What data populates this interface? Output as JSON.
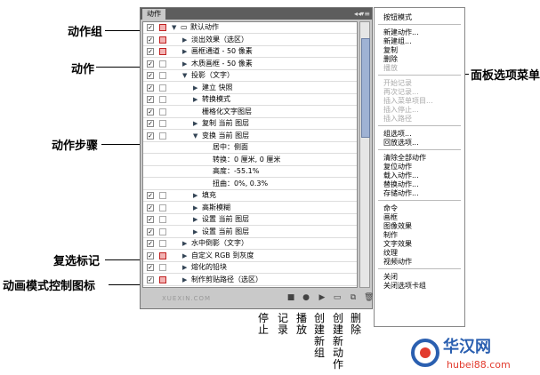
{
  "callouts": {
    "action_set": "动作组",
    "action": "动作",
    "action_step": "动作步骤",
    "toggle_check": "复选标记",
    "dialog_toggle": "动画模式控制图标",
    "panel_menu": "面板选项菜单"
  },
  "panel": {
    "tab": "动作",
    "collapse": "◂◂",
    "menu_icon": "▾≡",
    "watermark": "XUEXIN.COM",
    "rows": [
      {
        "label": "默认动作",
        "check": "✓",
        "dialog": "red",
        "tri": "▼",
        "indent": 0,
        "folder": true
      },
      {
        "label": "淡出效果（选区）",
        "check": "✓",
        "dialog": "red",
        "tri": "▶",
        "indent": 1
      },
      {
        "label": "画框通道 - 50 像素",
        "check": "✓",
        "dialog": "red",
        "tri": "▶",
        "indent": 1
      },
      {
        "label": "木质画框 - 50 像素",
        "check": "✓",
        "dialog": "",
        "tri": "▶",
        "indent": 1
      },
      {
        "label": "投影（文字）",
        "check": "✓",
        "dialog": "",
        "tri": "▼",
        "indent": 1
      },
      {
        "label": "建立 快照",
        "check": "✓",
        "dialog": "",
        "tri": "▶",
        "indent": 2
      },
      {
        "label": "转换模式",
        "check": "✓",
        "dialog": "",
        "tri": "▶",
        "indent": 2
      },
      {
        "label": "栅格化文字图层",
        "check": "✓",
        "dialog": "",
        "tri": "",
        "indent": 2
      },
      {
        "label": "复制 当前 图层",
        "check": "✓",
        "dialog": "",
        "tri": "▶",
        "indent": 2
      },
      {
        "label": "变换 当前 图层",
        "check": "✓",
        "dialog": "",
        "tri": "▼",
        "indent": 2
      },
      {
        "label": "居中：侧面",
        "check": "",
        "dialog": "none",
        "tri": "",
        "indent": 3
      },
      {
        "label": "转换：0 厘米, 0 厘米",
        "check": "",
        "dialog": "none",
        "tri": "",
        "indent": 3
      },
      {
        "label": "高度：-55.1%",
        "check": "",
        "dialog": "none",
        "tri": "",
        "indent": 3
      },
      {
        "label": "扭曲：0%, 0.3%",
        "check": "",
        "dialog": "none",
        "tri": "",
        "indent": 3
      },
      {
        "label": "填充",
        "check": "✓",
        "dialog": "",
        "tri": "▶",
        "indent": 2
      },
      {
        "label": "高斯模糊",
        "check": "✓",
        "dialog": "",
        "tri": "▶",
        "indent": 2
      },
      {
        "label": "设置 当前 图层",
        "check": "✓",
        "dialog": "",
        "tri": "▶",
        "indent": 2
      },
      {
        "label": "设置 当前 图层",
        "check": "✓",
        "dialog": "",
        "tri": "▶",
        "indent": 2
      },
      {
        "label": "水中倒影（文字）",
        "check": "✓",
        "dialog": "",
        "tri": "▶",
        "indent": 1
      },
      {
        "label": "自定义 RGB 到灰度",
        "check": "✓",
        "dialog": "red",
        "tri": "▶",
        "indent": 1
      },
      {
        "label": "熔化的铅块",
        "check": "✓",
        "dialog": "",
        "tri": "▶",
        "indent": 1
      },
      {
        "label": "制作剪贴路径（选区）",
        "check": "✓",
        "dialog": "red",
        "tri": "▶",
        "indent": 1
      }
    ],
    "buttons": [
      {
        "icon": "stop-icon",
        "glyph": "■",
        "label": "停止"
      },
      {
        "icon": "record-icon",
        "glyph": "●",
        "label": "记录"
      },
      {
        "icon": "play-icon",
        "glyph": "▶",
        "label": "播放"
      },
      {
        "icon": "new-set-icon",
        "glyph": "▭",
        "label": "创建新组"
      },
      {
        "icon": "new-action-icon",
        "glyph": "⧉",
        "label": "创建新动作"
      },
      {
        "icon": "trash-icon",
        "glyph": "🗑",
        "label": "删除"
      }
    ]
  },
  "menu": {
    "groups": [
      [
        {
          "t": "按钮模式"
        }
      ],
      [
        {
          "t": "新建动作..."
        },
        {
          "t": "新建组..."
        },
        {
          "t": "复制"
        },
        {
          "t": "删除"
        },
        {
          "t": "播放",
          "dis": true
        }
      ],
      [
        {
          "t": "开始记录",
          "dis": true
        },
        {
          "t": "再次记录...",
          "dis": true
        },
        {
          "t": "插入菜单项目...",
          "dis": true
        },
        {
          "t": "插入停止...",
          "dis": true
        },
        {
          "t": "插入路径",
          "dis": true
        }
      ],
      [
        {
          "t": "组选项..."
        },
        {
          "t": "回放选项..."
        }
      ],
      [
        {
          "t": "清除全部动作"
        },
        {
          "t": "复位动作"
        },
        {
          "t": "载入动作..."
        },
        {
          "t": "替换动作..."
        },
        {
          "t": "存储动作..."
        }
      ],
      [
        {
          "t": "命令"
        },
        {
          "t": "画框"
        },
        {
          "t": "图像效果"
        },
        {
          "t": "制作"
        },
        {
          "t": "文字效果"
        },
        {
          "t": "纹理"
        },
        {
          "t": "视频动作"
        }
      ],
      [
        {
          "t": "关闭"
        },
        {
          "t": "关闭选项卡组"
        }
      ]
    ]
  },
  "logo": {
    "name": "华汉网",
    "url": "hubei88.com"
  }
}
